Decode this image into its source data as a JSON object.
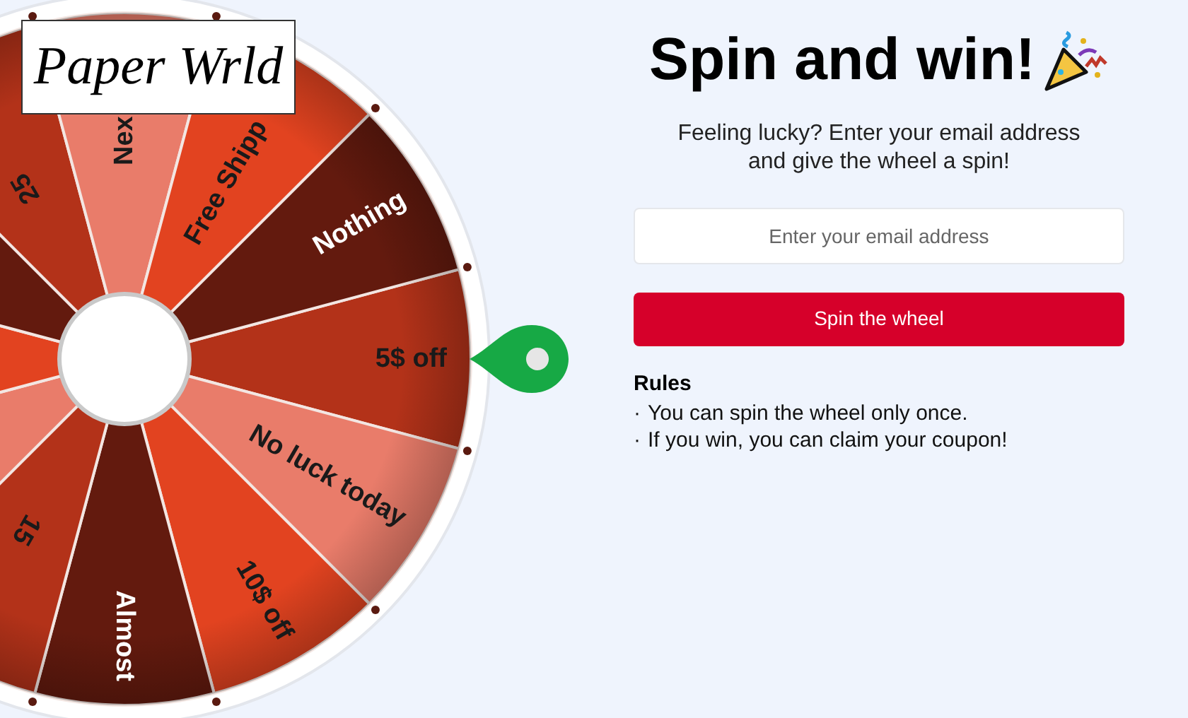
{
  "logo": {
    "text": "Paper Wrld"
  },
  "wheel": {
    "segments": [
      {
        "label": "5$ off",
        "color": "#b33219"
      },
      {
        "label": "No luck today",
        "color": "#e97c6a"
      },
      {
        "label": "10$ off",
        "color": "#e24320"
      },
      {
        "label": "Almost",
        "color": "#631a0e"
      },
      {
        "label": "15",
        "color": "#b33219"
      },
      {
        "color": "#e97c6a"
      },
      {
        "color": "#e24320"
      },
      {
        "color": "#631a0e"
      },
      {
        "label": "25",
        "color": "#b33219"
      },
      {
        "label": "Nex",
        "color": "#e97c6a"
      },
      {
        "label": "Free Shipp",
        "color": "#e24320"
      },
      {
        "label": "Nothing",
        "color": "#631a0e"
      }
    ]
  },
  "title": "Spin and win!",
  "subtitle": "Feeling lucky? Enter your email address and give the wheel a spin!",
  "email": {
    "placeholder": "Enter your email address"
  },
  "spin_button": "Spin the wheel",
  "rules": {
    "heading": "Rules",
    "items": [
      "You can spin the wheel only once.",
      "If you win, you can claim your coupon!"
    ],
    "bullet": "·"
  }
}
